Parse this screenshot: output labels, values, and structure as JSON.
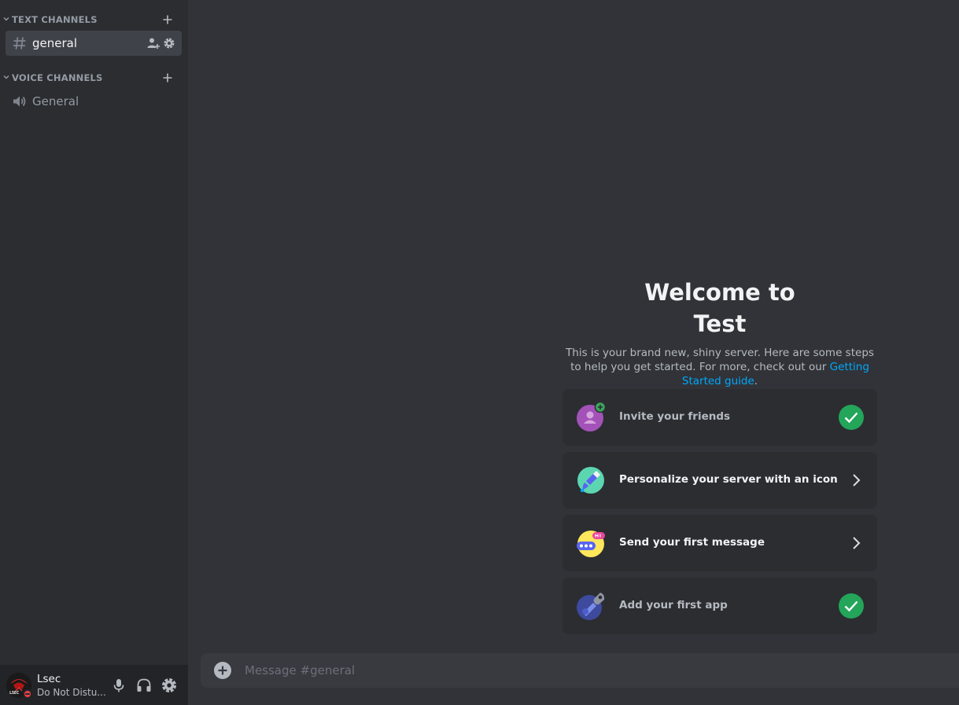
{
  "sidebar": {
    "categories": [
      {
        "label": "TEXT CHANNELS"
      },
      {
        "label": "VOICE CHANNELS"
      }
    ],
    "channels": [
      {
        "name": "general",
        "type": "text",
        "active": true,
        "icon": "hash-icon"
      },
      {
        "name": "General",
        "type": "voice",
        "active": false,
        "icon": "speaker-icon"
      }
    ]
  },
  "user": {
    "name": "Lsec",
    "status": "Do Not Distu...",
    "avatar_text": "LSEC",
    "status_color": "#f23f43"
  },
  "welcome": {
    "title_line1": "Welcome to",
    "title_line2": "Test",
    "desc_text": "This is your brand new, shiny server. Here are some steps to help you get started. For more, check out our ",
    "desc_link": "Getting Started guide",
    "desc_end": "."
  },
  "cards": [
    {
      "label": "Invite your friends",
      "done": true,
      "icon": "invite-friends-icon"
    },
    {
      "label": "Personalize your server with an icon",
      "done": false,
      "icon": "paintbrush-icon"
    },
    {
      "label": "Send your first message",
      "done": false,
      "icon": "chat-bubble-icon"
    },
    {
      "label": "Add your first app",
      "done": true,
      "icon": "wrench-app-icon"
    }
  ],
  "composer": {
    "placeholder": "Message #general"
  },
  "colors": {
    "sidebar_bg": "#2b2d31",
    "main_bg": "#313338",
    "success_green": "#23a55a",
    "link_blue": "#00a8fc"
  }
}
